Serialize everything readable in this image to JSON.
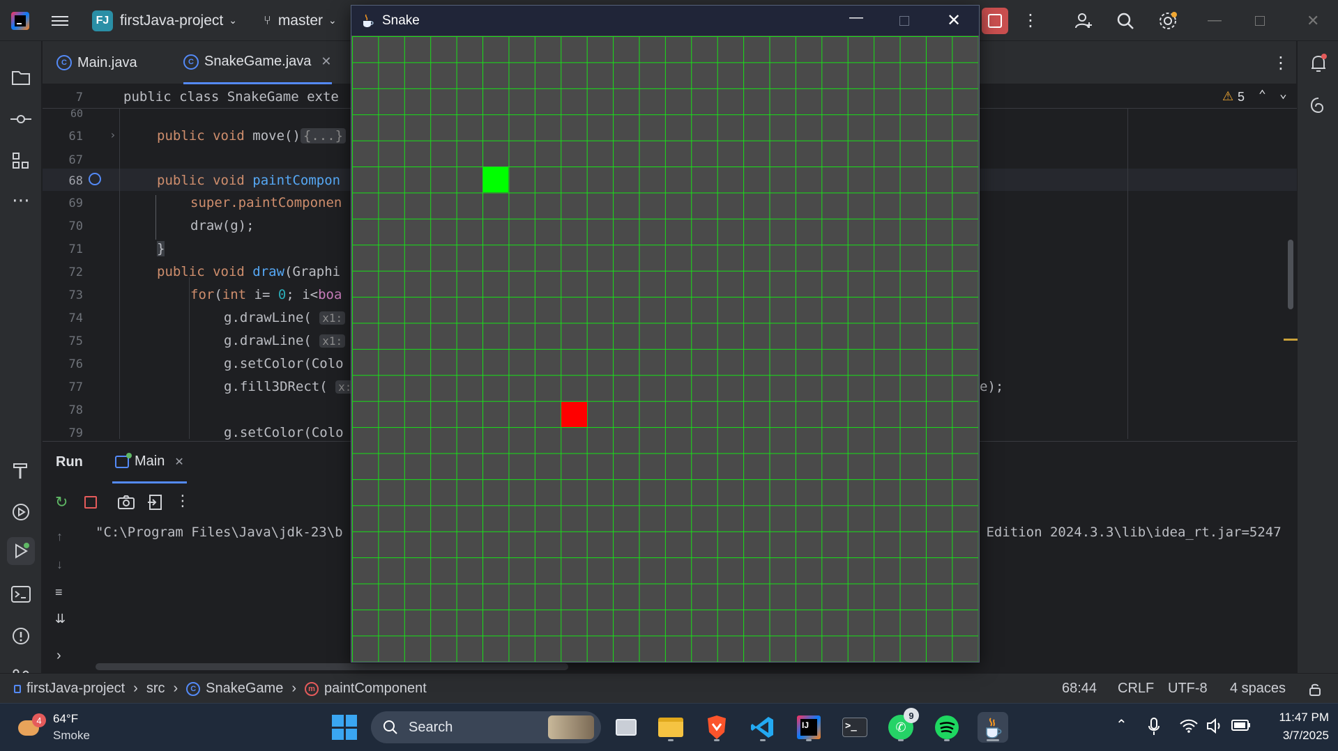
{
  "titlebar": {
    "project_badge": "FJ",
    "project_name": "firstJava-project",
    "branch": "master"
  },
  "tabs": [
    {
      "label": "Main.java"
    },
    {
      "label": "SnakeGame.java"
    }
  ],
  "editor": {
    "sticky_line_num": "7",
    "sticky_line": "public class SnakeGame exte",
    "warnings_count": "5",
    "lines": [
      {
        "num": "60",
        "text": ""
      },
      {
        "num": "61",
        "text": "public void move(){...}"
      },
      {
        "num": "67",
        "text": ""
      },
      {
        "num": "68",
        "text": "public void paintCompon"
      },
      {
        "num": "69",
        "text": "super.paintComponen"
      },
      {
        "num": "70",
        "text": "draw(g);"
      },
      {
        "num": "71",
        "text": "}"
      },
      {
        "num": "72",
        "text": "public void draw(Graphi"
      },
      {
        "num": "73",
        "text": "for(int i= 0; i<boa"
      },
      {
        "num": "74",
        "text": "g.drawLine( x1: i"
      },
      {
        "num": "75",
        "text": "g.drawLine( x1: 0"
      },
      {
        "num": "76",
        "text": "g.setColor(Colo"
      },
      {
        "num": "77",
        "text": "g.fill3DRect( x:"
      },
      {
        "num": "78",
        "text": ""
      },
      {
        "num": "79",
        "text": "g.setColor(Colo"
      }
    ],
    "line77_tail": "e);"
  },
  "run": {
    "title": "Run",
    "tab_label": "Main",
    "console_left": "\"C:\\Program Files\\Java\\jdk-23\\b",
    "console_right": " Edition 2024.3.3\\lib\\idea_rt.jar=5247"
  },
  "statusbar": {
    "breadcrumbs": [
      "firstJava-project",
      "src",
      "SnakeGame",
      "paintComponent"
    ],
    "position": "68:44",
    "line_sep": "CRLF",
    "encoding": "UTF-8",
    "indent": "4 spaces"
  },
  "snake_window": {
    "title": "Snake",
    "grid_cells": 24,
    "snake_head": {
      "col": 5,
      "row": 5,
      "color": "#00ff00"
    },
    "food": {
      "col": 8,
      "row": 14,
      "color": "#ff0000"
    },
    "grid_line_color": "#18e018",
    "background": "#4a4a4a"
  },
  "taskbar": {
    "weather_temp": "64°F",
    "weather_desc": "Smoke",
    "weather_badge": "4",
    "search_placeholder": "Search",
    "whatsapp_badge": "9",
    "time": "11:47 PM",
    "date": "3/7/2025"
  }
}
